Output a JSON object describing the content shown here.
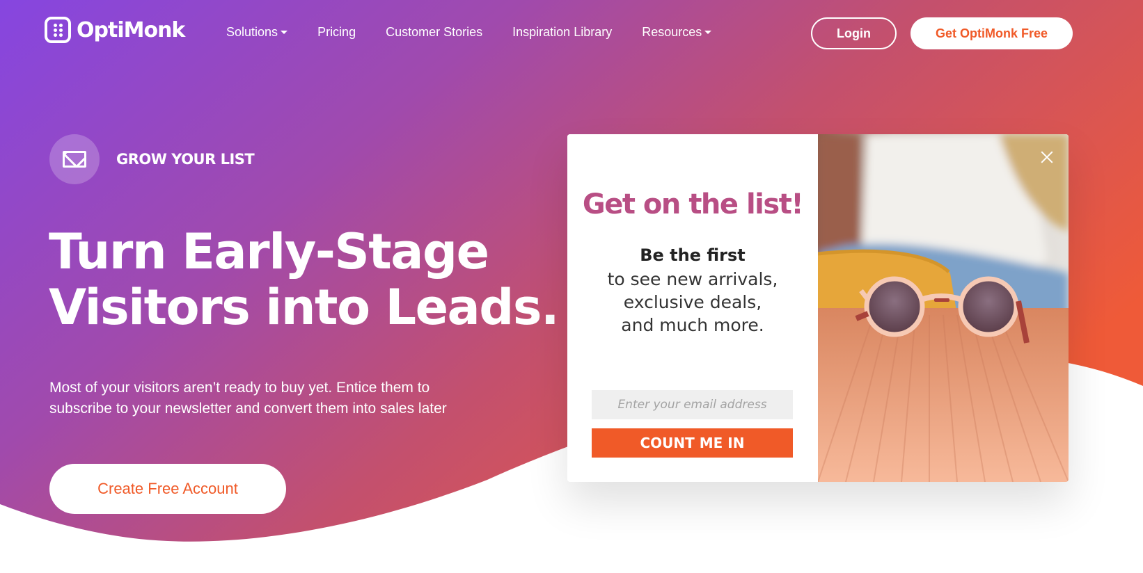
{
  "nav": {
    "logo_text": "OptiMonk",
    "links": [
      {
        "label": "Solutions",
        "has_dropdown": true
      },
      {
        "label": "Pricing",
        "has_dropdown": false
      },
      {
        "label": "Customer Stories",
        "has_dropdown": false
      },
      {
        "label": "Inspiration Library",
        "has_dropdown": false
      },
      {
        "label": "Resources",
        "has_dropdown": true
      }
    ],
    "login_label": "Login",
    "get_free_label": "Get OptiMonk Free"
  },
  "hero": {
    "badge_icon": "envelope-icon",
    "badge_label": "GROW YOUR LIST",
    "headline_line1": "Turn Early-Stage",
    "headline_line2": "Visitors into Leads.",
    "subtext": "Most of your visitors aren’t ready to buy yet. Entice them to subscribe to your newsletter and convert them into sales later",
    "cta_label": "Create Free Account"
  },
  "popup": {
    "title": "Get on the list!",
    "lead": "Be the first",
    "body_line1": "to see new arrivals,",
    "body_line2": "exclusive deals,",
    "body_line3": "and much more.",
    "email_placeholder": "Enter your email address",
    "email_value": "",
    "submit_label": "COUNT ME IN",
    "close_icon": "close-icon",
    "image_description": "sunglasses on a yellow case on a wooden deck"
  },
  "colors": {
    "gradient_start": "#8646e0",
    "gradient_mid": "#b04c8e",
    "gradient_end": "#ef5a38",
    "accent_orange": "#f05a28",
    "popup_title": "#b84e84"
  }
}
